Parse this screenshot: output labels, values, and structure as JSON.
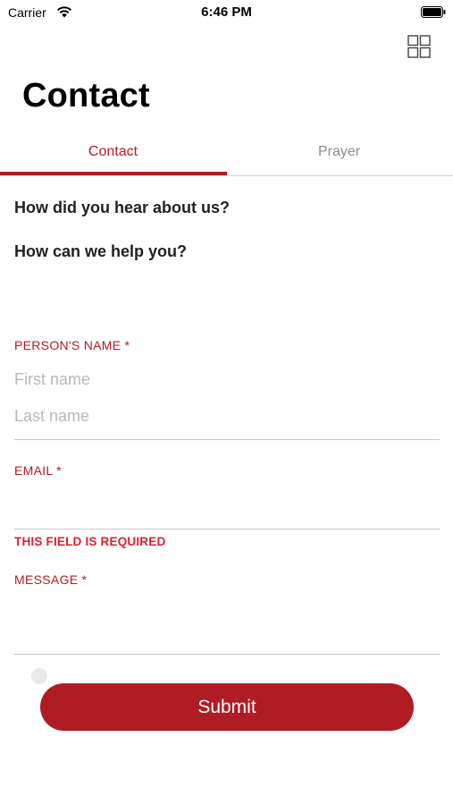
{
  "status_bar": {
    "carrier": "Carrier",
    "time": "6:46 PM"
  },
  "header": {
    "title": "Contact",
    "menu_icon": "grid-icon"
  },
  "tabs": [
    {
      "label": "Contact",
      "active": true
    },
    {
      "label": "Prayer",
      "active": false
    }
  ],
  "form": {
    "questions": [
      "How did you hear about us?",
      "How can we help you?"
    ],
    "name": {
      "label": "PERSON'S NAME *",
      "first_placeholder": "First name",
      "last_placeholder": "Last name",
      "first_value": "",
      "last_value": ""
    },
    "email": {
      "label": "EMAIL *",
      "value": "",
      "error": "THIS FIELD IS REQUIRED"
    },
    "message": {
      "label": "MESSAGE *",
      "value": ""
    },
    "submit_label": "Submit"
  },
  "colors": {
    "accent": "#b01c24",
    "error": "#e0202a",
    "placeholder": "#b8b8b8",
    "inactive_tab": "#8c8c8c"
  }
}
